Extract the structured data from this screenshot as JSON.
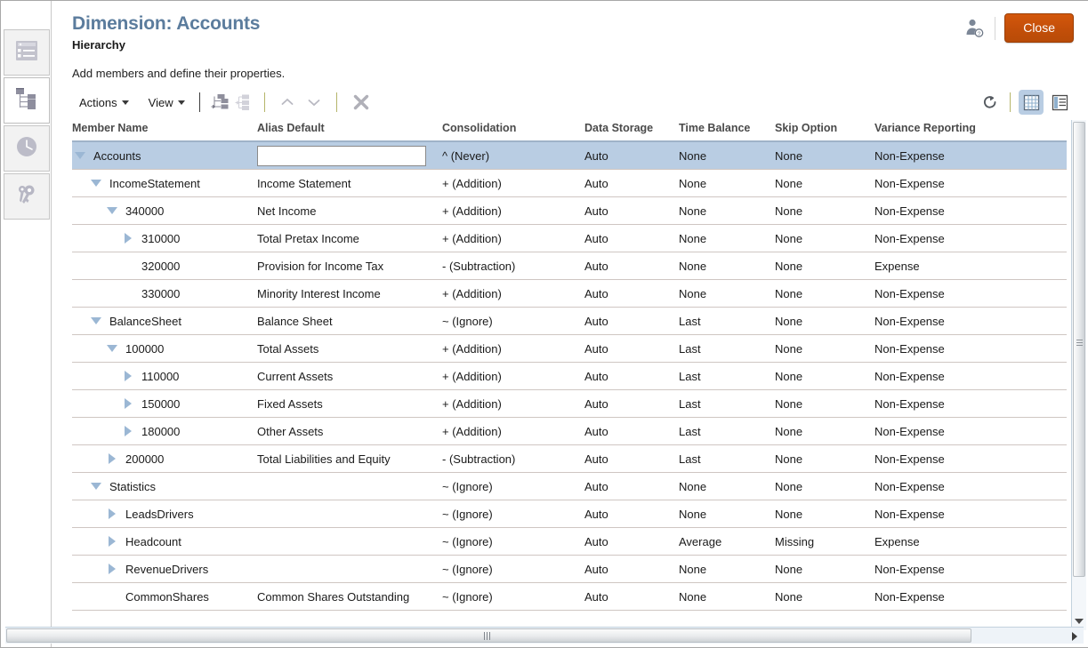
{
  "window": {
    "title": "Dimension: Accounts",
    "subtitle": "Hierarchy",
    "instruction": "Add members and define their properties.",
    "close_label": "Close",
    "user_icon": "user-permissions-icon"
  },
  "sidebar": {
    "items": [
      {
        "name": "dimension-list",
        "icon": "list-icon",
        "selected": false
      },
      {
        "name": "hierarchy",
        "icon": "hierarchy-tree-icon",
        "selected": true
      },
      {
        "name": "history",
        "icon": "clock-icon",
        "selected": false
      },
      {
        "name": "permissions",
        "icon": "key-icon",
        "selected": false
      }
    ]
  },
  "toolbar": {
    "actions_label": "Actions",
    "view_label": "View",
    "icons": [
      {
        "name": "add-child-member-icon",
        "enabled": true
      },
      {
        "name": "add-sibling-member-icon",
        "enabled": false
      },
      {
        "name": "move-up-icon",
        "enabled": false
      },
      {
        "name": "move-down-icon",
        "enabled": false
      },
      {
        "name": "delete-member-icon",
        "enabled": true
      }
    ],
    "right_icons": [
      {
        "name": "refresh-icon",
        "active": false
      },
      {
        "name": "grid-view-icon",
        "active": true
      },
      {
        "name": "detail-view-icon",
        "active": false
      }
    ]
  },
  "grid": {
    "columns": [
      "Member Name",
      "Alias Default",
      "Consolidation",
      "Data Storage",
      "Time Balance",
      "Skip Option",
      "Variance Reporting"
    ],
    "rows": [
      {
        "member": "Accounts",
        "indent": 0,
        "twisty": "down",
        "selected": true,
        "alias": "",
        "alias_editing": true,
        "alias_placeholder": "",
        "consolidation": "^ (Never)",
        "data_storage": "Auto",
        "time_balance": "None",
        "skip_option": "None",
        "variance": "Non-Expense"
      },
      {
        "member": "IncomeStatement",
        "indent": 1,
        "twisty": "down",
        "selected": false,
        "alias": "Income Statement",
        "alias_editing": false,
        "consolidation": "+ (Addition)",
        "data_storage": "Auto",
        "time_balance": "None",
        "skip_option": "None",
        "variance": "Non-Expense"
      },
      {
        "member": "340000",
        "indent": 2,
        "twisty": "down",
        "selected": false,
        "alias": "Net Income",
        "alias_editing": false,
        "consolidation": "+ (Addition)",
        "data_storage": "Auto",
        "time_balance": "None",
        "skip_option": "None",
        "variance": "Non-Expense"
      },
      {
        "member": "310000",
        "indent": 3,
        "twisty": "right",
        "selected": false,
        "alias": "Total Pretax Income",
        "alias_editing": false,
        "consolidation": "+ (Addition)",
        "data_storage": "Auto",
        "time_balance": "None",
        "skip_option": "None",
        "variance": "Non-Expense"
      },
      {
        "member": "320000",
        "indent": 3,
        "twisty": "none",
        "selected": false,
        "alias": "Provision for Income Tax",
        "alias_editing": false,
        "consolidation": "- (Subtraction)",
        "data_storage": "Auto",
        "time_balance": "None",
        "skip_option": "None",
        "variance": "Expense"
      },
      {
        "member": "330000",
        "indent": 3,
        "twisty": "none",
        "selected": false,
        "alias": "Minority Interest Income",
        "alias_editing": false,
        "consolidation": "+ (Addition)",
        "data_storage": "Auto",
        "time_balance": "None",
        "skip_option": "None",
        "variance": "Non-Expense"
      },
      {
        "member": "BalanceSheet",
        "indent": 1,
        "twisty": "down",
        "selected": false,
        "alias": "Balance Sheet",
        "alias_editing": false,
        "consolidation": "~ (Ignore)",
        "data_storage": "Auto",
        "time_balance": "Last",
        "skip_option": "None",
        "variance": "Non-Expense"
      },
      {
        "member": "100000",
        "indent": 2,
        "twisty": "down",
        "selected": false,
        "alias": "Total Assets",
        "alias_editing": false,
        "consolidation": "+ (Addition)",
        "data_storage": "Auto",
        "time_balance": "Last",
        "skip_option": "None",
        "variance": "Non-Expense"
      },
      {
        "member": "110000",
        "indent": 3,
        "twisty": "right",
        "selected": false,
        "alias": "Current Assets",
        "alias_editing": false,
        "consolidation": "+ (Addition)",
        "data_storage": "Auto",
        "time_balance": "Last",
        "skip_option": "None",
        "variance": "Non-Expense"
      },
      {
        "member": "150000",
        "indent": 3,
        "twisty": "right",
        "selected": false,
        "alias": "Fixed Assets",
        "alias_editing": false,
        "consolidation": "+ (Addition)",
        "data_storage": "Auto",
        "time_balance": "Last",
        "skip_option": "None",
        "variance": "Non-Expense"
      },
      {
        "member": "180000",
        "indent": 3,
        "twisty": "right",
        "selected": false,
        "alias": "Other Assets",
        "alias_editing": false,
        "consolidation": "+ (Addition)",
        "data_storage": "Auto",
        "time_balance": "Last",
        "skip_option": "None",
        "variance": "Non-Expense"
      },
      {
        "member": "200000",
        "indent": 2,
        "twisty": "right",
        "selected": false,
        "alias": "Total Liabilities and Equity",
        "alias_editing": false,
        "consolidation": "- (Subtraction)",
        "data_storage": "Auto",
        "time_balance": "Last",
        "skip_option": "None",
        "variance": "Non-Expense"
      },
      {
        "member": "Statistics",
        "indent": 1,
        "twisty": "down",
        "selected": false,
        "alias": "",
        "alias_editing": false,
        "consolidation": "~ (Ignore)",
        "data_storage": "Auto",
        "time_balance": "None",
        "skip_option": "None",
        "variance": "Non-Expense"
      },
      {
        "member": "LeadsDrivers",
        "indent": 2,
        "twisty": "right",
        "selected": false,
        "alias": "",
        "alias_editing": false,
        "consolidation": "~ (Ignore)",
        "data_storage": "Auto",
        "time_balance": "None",
        "skip_option": "None",
        "variance": "Non-Expense"
      },
      {
        "member": "Headcount",
        "indent": 2,
        "twisty": "right",
        "selected": false,
        "alias": "",
        "alias_editing": false,
        "consolidation": "~ (Ignore)",
        "data_storage": "Auto",
        "time_balance": "Average",
        "skip_option": "Missing",
        "variance": "Expense"
      },
      {
        "member": "RevenueDrivers",
        "indent": 2,
        "twisty": "right",
        "selected": false,
        "alias": "",
        "alias_editing": false,
        "consolidation": "~ (Ignore)",
        "data_storage": "Auto",
        "time_balance": "None",
        "skip_option": "None",
        "variance": "Non-Expense"
      },
      {
        "member": "CommonShares",
        "indent": 2,
        "twisty": "none",
        "selected": false,
        "alias": "Common Shares Outstanding",
        "alias_editing": false,
        "consolidation": "~ (Ignore)",
        "data_storage": "Auto",
        "time_balance": "None",
        "skip_option": "None",
        "variance": "Non-Expense"
      }
    ]
  },
  "colors": {
    "title": "#5b7c9d",
    "close_button": "#c44f09",
    "selected_row": "#b9cde3",
    "twisty": "#9bb7d4",
    "header_rule": "#9fb3c8"
  }
}
